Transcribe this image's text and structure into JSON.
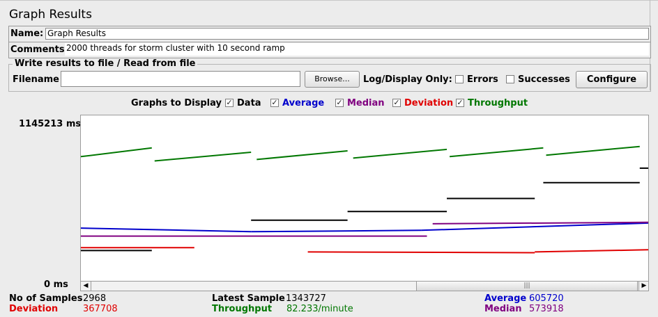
{
  "title": "Graph Results",
  "name_label": "Name:",
  "name_value": "Graph Results",
  "comments_label": "Comments:",
  "comments_value": "2000 threads for storm cluster with 10 second ramp",
  "file_group_title": "Write results to file / Read from file",
  "filename_label": "Filename",
  "filename_value": "",
  "browse_label": "Browse...",
  "log_display_label": "Log/Display Only:",
  "errors_label": "Errors",
  "successes_label": "Successes",
  "configure_label": "Configure",
  "graphs_label": "Graphs to Display",
  "graph_options": [
    {
      "label": "Data",
      "color": "#000000",
      "checked": true
    },
    {
      "label": "Average",
      "color": "#0000cc",
      "checked": true
    },
    {
      "label": "Median",
      "color": "#800080",
      "checked": true
    },
    {
      "label": "Deviation",
      "color": "#e00000",
      "checked": true
    },
    {
      "label": "Throughput",
      "color": "#007700",
      "checked": true
    }
  ],
  "y_max_label": "1145213 ms",
  "y_min_label": "0 ms",
  "colors": {
    "data": "#000000",
    "average": "#0000cc",
    "median": "#800080",
    "deviation": "#e00000",
    "throughput": "#007700"
  },
  "stats": {
    "samples_label": "No of Samples",
    "samples_value": "2968",
    "latest_label": "Latest Sample",
    "latest_value": "1343727",
    "average_label": "Average",
    "average_value": "605720",
    "deviation_label": "Deviation",
    "deviation_value": "367708",
    "throughput_label": "Throughput",
    "throughput_value": "82.233/minute",
    "median_label": "Median",
    "median_value": "573918"
  },
  "chart_data": {
    "type": "line",
    "ylim": [
      0,
      1145213
    ],
    "series": [
      {
        "name": "Throughput",
        "color": "#007700",
        "segments": [
          [
            0,
            860000,
            0.125,
            920000
          ],
          [
            0.13,
            830000,
            0.3,
            890000
          ],
          [
            0.31,
            840000,
            0.47,
            900000
          ],
          [
            0.48,
            850000,
            0.645,
            910000
          ],
          [
            0.65,
            860000,
            0.815,
            920000
          ],
          [
            0.82,
            870000,
            0.985,
            930000
          ]
        ]
      },
      {
        "name": "Data",
        "color": "#000000",
        "segments": [
          [
            0,
            210000,
            0.125,
            210000
          ],
          [
            0.3,
            420000,
            0.47,
            420000
          ],
          [
            0.47,
            480000,
            0.645,
            480000
          ],
          [
            0.645,
            570000,
            0.8,
            570000
          ],
          [
            0.815,
            680000,
            0.985,
            680000
          ],
          [
            0.985,
            780000,
            1,
            780000
          ]
        ]
      },
      {
        "name": "Average",
        "color": "#0000cc",
        "segments": [
          [
            0,
            365000,
            0.3,
            340000
          ],
          [
            0.3,
            340000,
            0.6,
            350000
          ],
          [
            0.6,
            350000,
            1,
            400000
          ]
        ]
      },
      {
        "name": "Median",
        "color": "#800080",
        "segments": [
          [
            0,
            310000,
            0.61,
            310000
          ],
          [
            0.62,
            395000,
            1,
            405000
          ]
        ]
      },
      {
        "name": "Deviation",
        "color": "#e00000",
        "segments": [
          [
            0,
            230000,
            0.2,
            230000
          ],
          [
            0.4,
            200000,
            0.8,
            195000
          ],
          [
            0.8,
            200000,
            1,
            215000
          ]
        ]
      }
    ]
  }
}
